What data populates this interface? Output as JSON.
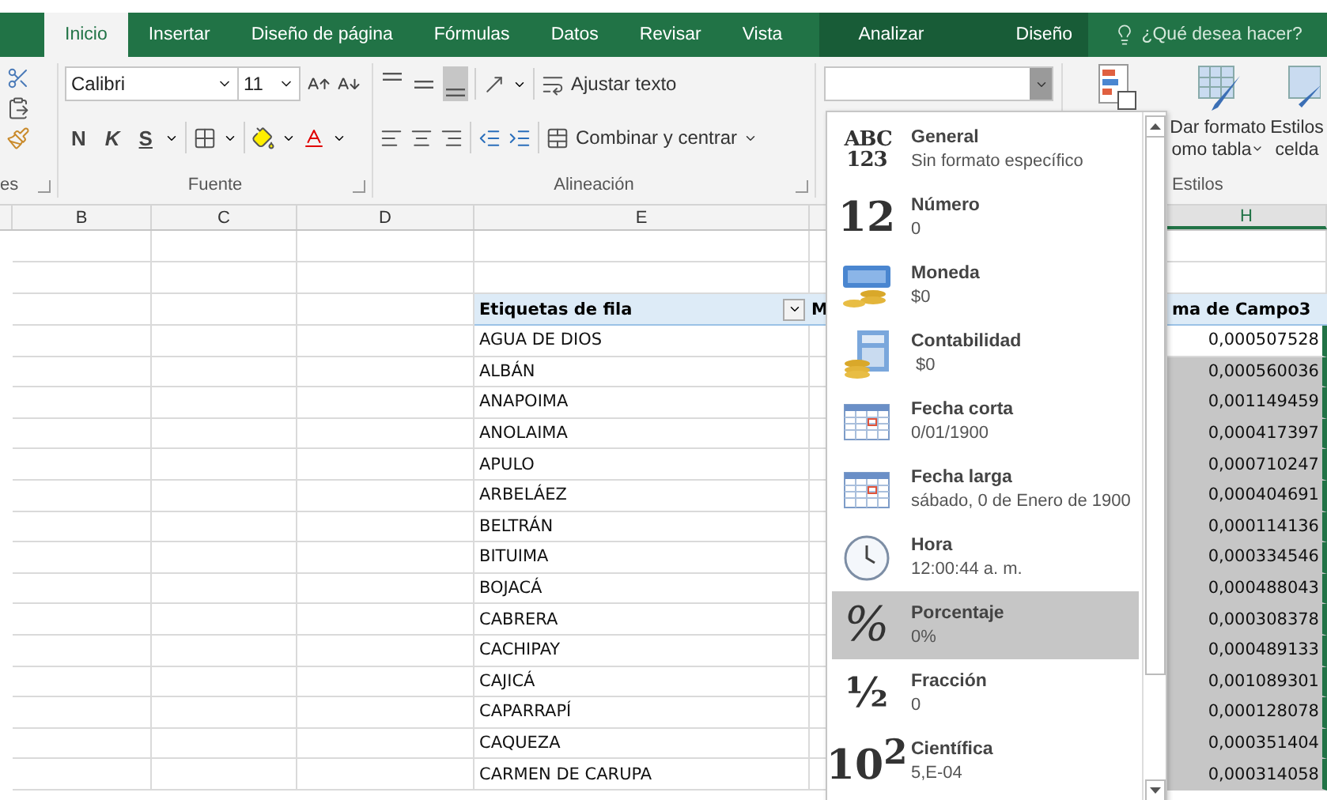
{
  "tabs": [
    {
      "label": "Inicio",
      "selected": true,
      "kind": "main"
    },
    {
      "label": "Insertar",
      "selected": false,
      "kind": "main"
    },
    {
      "label": "Diseño de página",
      "selected": false,
      "kind": "main"
    },
    {
      "label": "Fórmulas",
      "selected": false,
      "kind": "main"
    },
    {
      "label": "Datos",
      "selected": false,
      "kind": "main"
    },
    {
      "label": "Revisar",
      "selected": false,
      "kind": "main"
    },
    {
      "label": "Vista",
      "selected": false,
      "kind": "main"
    },
    {
      "label": "Analizar",
      "selected": false,
      "kind": "context"
    },
    {
      "label": "Diseño",
      "selected": false,
      "kind": "context"
    }
  ],
  "tell_me": {
    "placeholder": "¿Qué desea hacer?"
  },
  "ribbon": {
    "clipboard": {
      "label": "es"
    },
    "font": {
      "label": "Fuente",
      "font_name": "Calibri",
      "font_size": "11",
      "bold": "N",
      "italic": "K",
      "underline": "S"
    },
    "alignment": {
      "label": "Alineación",
      "wrap_text": "Ajustar texto",
      "merge": "Combinar y centrar"
    },
    "styles": {
      "label": "Estilos",
      "format_as_table": [
        "Dar formato",
        "omo tabla"
      ],
      "cell_styles": [
        "Estilos",
        "celda"
      ]
    }
  },
  "columns": [
    {
      "label": "B",
      "selected": false
    },
    {
      "label": "C",
      "selected": false
    },
    {
      "label": "D",
      "selected": false
    },
    {
      "label": "E",
      "selected": false
    },
    {
      "label": "H",
      "selected": true
    }
  ],
  "pivot": {
    "row_header": "Etiquetas de fila",
    "next_header": "M",
    "value_header": "ma de Campo3",
    "rows": [
      {
        "label": "AGUA DE DIOS",
        "value": "0,000507528",
        "selected": false
      },
      {
        "label": "ALBÁN",
        "value": "0,000560036",
        "selected": true
      },
      {
        "label": "ANAPOIMA",
        "value": "0,001149459",
        "selected": true
      },
      {
        "label": "ANOLAIMA",
        "value": "0,000417397",
        "selected": true
      },
      {
        "label": "APULO",
        "value": "0,000710247",
        "selected": true
      },
      {
        "label": "ARBELÁEZ",
        "value": "0,000404691",
        "selected": true
      },
      {
        "label": "BELTRÁN",
        "value": "0,000114136",
        "selected": true
      },
      {
        "label": "BITUIMA",
        "value": "0,000334546",
        "selected": true
      },
      {
        "label": "BOJACÁ",
        "value": "0,000488043",
        "selected": true
      },
      {
        "label": "CABRERA",
        "value": "0,000308378",
        "selected": true
      },
      {
        "label": "CACHIPAY",
        "value": "0,000489133",
        "selected": true
      },
      {
        "label": "CAJICÁ",
        "value": "0,001089301",
        "selected": true
      },
      {
        "label": "CAPARRAPÍ",
        "value": "0,000128078",
        "selected": true
      },
      {
        "label": "CAQUEZA",
        "value": "0,000351404",
        "selected": true
      },
      {
        "label": "CARMEN DE CARUPA",
        "value": "0,000314058",
        "selected": true
      }
    ]
  },
  "format_menu": {
    "items": [
      {
        "kind": "glyph",
        "glyph": "ABC 123",
        "title": "General",
        "example": "Sin formato específico",
        "selected": false
      },
      {
        "kind": "glyph",
        "glyph": "12",
        "title": "Número",
        "example": "0",
        "selected": false
      },
      {
        "kind": "currency",
        "title": "Moneda",
        "example": "$0",
        "selected": false
      },
      {
        "kind": "accounting",
        "title": "Contabilidad",
        "example": " $0",
        "selected": false
      },
      {
        "kind": "calendar",
        "title": "Fecha corta",
        "example": "0/01/1900",
        "selected": false
      },
      {
        "kind": "calendar",
        "title": "Fecha larga",
        "example": "sábado, 0 de Enero de 1900",
        "selected": false
      },
      {
        "kind": "clock",
        "title": "Hora",
        "example": "12:00:44 a. m.",
        "selected": false
      },
      {
        "kind": "glyph",
        "glyph": "%",
        "title": "Porcentaje",
        "example": "0%",
        "selected": true
      },
      {
        "kind": "glyph",
        "glyph": "½",
        "title": "Fracción",
        "example": "0",
        "selected": false
      },
      {
        "kind": "glyph",
        "glyph": "10$^{2}$",
        "title": "Científica",
        "example": "5,E-04",
        "selected": false
      }
    ]
  }
}
